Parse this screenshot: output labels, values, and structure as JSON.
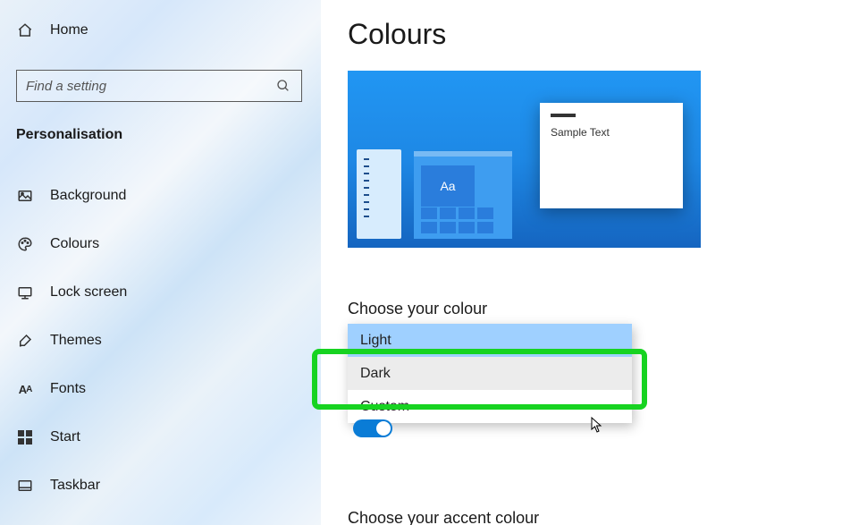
{
  "sidebar": {
    "home": "Home",
    "search_placeholder": "Find a setting",
    "section": "Personalisation",
    "items": [
      {
        "icon": "image-icon",
        "label": "Background"
      },
      {
        "icon": "palette-icon",
        "label": "Colours"
      },
      {
        "icon": "monitor-icon",
        "label": "Lock screen"
      },
      {
        "icon": "brush-icon",
        "label": "Themes"
      },
      {
        "icon": "font-icon",
        "label": "Fonts"
      },
      {
        "icon": "start-icon",
        "label": "Start"
      },
      {
        "icon": "taskbar-icon",
        "label": "Taskbar"
      }
    ]
  },
  "main": {
    "title": "Colours",
    "preview": {
      "sample_text": "Sample Text",
      "tile_label": "Aa"
    },
    "choose_colour_label": "Choose your colour",
    "dropdown": {
      "options": [
        "Light",
        "Dark",
        "Custom"
      ],
      "selected": "Light",
      "hovered": "Dark"
    },
    "transparency_state": "On",
    "choose_accent_label": "Choose your accent colour"
  }
}
